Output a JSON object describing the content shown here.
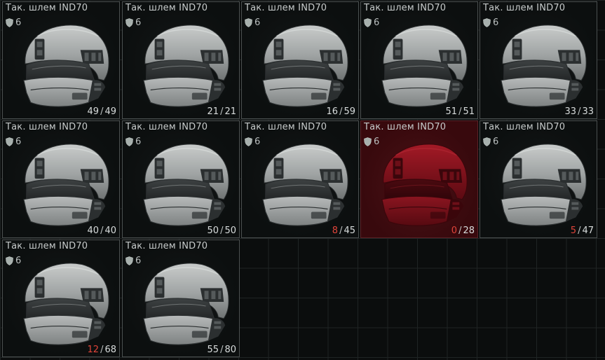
{
  "items": [
    {
      "name": "Так. шлем IND70",
      "armor_class": "6",
      "durability_current": "49",
      "durability_max": "49",
      "low": false,
      "broken": false
    },
    {
      "name": "Так. шлем IND70",
      "armor_class": "6",
      "durability_current": "21",
      "durability_max": "21",
      "low": false,
      "broken": false
    },
    {
      "name": "Так. шлем IND70",
      "armor_class": "6",
      "durability_current": "16",
      "durability_max": "59",
      "low": false,
      "broken": false
    },
    {
      "name": "Так. шлем IND70",
      "armor_class": "6",
      "durability_current": "51",
      "durability_max": "51",
      "low": false,
      "broken": false
    },
    {
      "name": "Так. шлем IND70",
      "armor_class": "6",
      "durability_current": "33",
      "durability_max": "33",
      "low": false,
      "broken": false
    },
    {
      "name": "Так. шлем IND70",
      "armor_class": "6",
      "durability_current": "40",
      "durability_max": "40",
      "low": false,
      "broken": false
    },
    {
      "name": "Так. шлем IND70",
      "armor_class": "6",
      "durability_current": "50",
      "durability_max": "50",
      "low": false,
      "broken": false
    },
    {
      "name": "Так. шлем IND70",
      "armor_class": "6",
      "durability_current": "8",
      "durability_max": "45",
      "low": true,
      "broken": false
    },
    {
      "name": "Так. шлем IND70",
      "armor_class": "6",
      "durability_current": "0",
      "durability_max": "28",
      "low": true,
      "broken": true
    },
    {
      "name": "Так. шлем IND70",
      "armor_class": "6",
      "durability_current": "5",
      "durability_max": "47",
      "low": true,
      "broken": false
    },
    {
      "name": "Так. шлем IND70",
      "armor_class": "6",
      "durability_current": "12",
      "durability_max": "68",
      "low": true,
      "broken": false
    },
    {
      "name": "Так. шлем IND70",
      "armor_class": "6",
      "durability_current": "55",
      "durability_max": "80",
      "low": false,
      "broken": false
    }
  ],
  "icons": {
    "armor": "shield-icon",
    "item": "helmet-icon"
  },
  "colors": {
    "low_durability": "#e0443a",
    "broken_bg": "#3e0b10"
  }
}
